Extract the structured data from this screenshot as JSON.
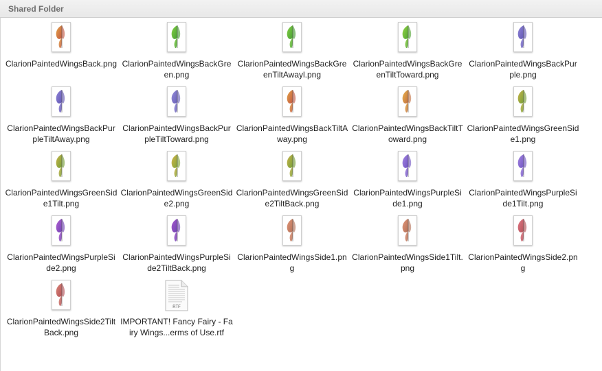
{
  "folder": {
    "title": "Shared Folder"
  },
  "files": [
    {
      "name": "ClarionPaintedWingsBack.png",
      "icon": "wing-thumbnail-icon",
      "c1": "#e2a03c",
      "c2": "#c0503a"
    },
    {
      "name": "ClarionPaintedWingsBackGreen.png",
      "icon": "wing-thumbnail-icon",
      "c1": "#7fcf3a",
      "c2": "#3e9a2a"
    },
    {
      "name": "ClarionPaintedWingsBackGreenTiltAwayl.png",
      "icon": "wing-thumbnail-icon",
      "c1": "#7fcf3a",
      "c2": "#3e9a2a"
    },
    {
      "name": "ClarionPaintedWingsBackGreenTiltToward.png",
      "icon": "wing-thumbnail-icon",
      "c1": "#8fd43a",
      "c2": "#4aa02a"
    },
    {
      "name": "ClarionPaintedWingsBackPurple.png",
      "icon": "wing-thumbnail-icon",
      "c1": "#8a7fd6",
      "c2": "#5b4fb0"
    },
    {
      "name": "ClarionPaintedWingsBackPurpleTiltAway.png",
      "icon": "wing-thumbnail-icon",
      "c1": "#8a7fd6",
      "c2": "#5b4fb0"
    },
    {
      "name": "ClarionPaintedWingsBackPurpleTiltToward.png",
      "icon": "wing-thumbnail-icon",
      "c1": "#9088d8",
      "c2": "#6258b4"
    },
    {
      "name": "ClarionPaintedWingsBackTiltAway.png",
      "icon": "wing-thumbnail-icon",
      "c1": "#e2a03c",
      "c2": "#c0503a"
    },
    {
      "name": "ClarionPaintedWingsBackTiltToward.png",
      "icon": "wing-thumbnail-icon",
      "c1": "#e8b040",
      "c2": "#c06a3a"
    },
    {
      "name": "ClarionPaintedWingsGreenSide1.png",
      "icon": "wing-thumbnail-icon",
      "c1": "#c8b040",
      "c2": "#6f9a2e"
    },
    {
      "name": "ClarionPaintedWingsGreenSide1Tilt.png",
      "icon": "wing-thumbnail-icon",
      "c1": "#c8b040",
      "c2": "#6f9a2e"
    },
    {
      "name": "ClarionPaintedWingsGreenSide2.png",
      "icon": "wing-thumbnail-icon",
      "c1": "#d4b040",
      "c2": "#7aa030"
    },
    {
      "name": "ClarionPaintedWingsGreenSide2TiltBack.png",
      "icon": "wing-thumbnail-icon",
      "c1": "#c8b040",
      "c2": "#6f9a2e"
    },
    {
      "name": "ClarionPaintedWingsPurpleSide1.png",
      "icon": "wing-thumbnail-icon",
      "c1": "#a080e0",
      "c2": "#6a4cc0"
    },
    {
      "name": "ClarionPaintedWingsPurpleSide1Tilt.png",
      "icon": "wing-thumbnail-icon",
      "c1": "#a080e0",
      "c2": "#6a4cc0"
    },
    {
      "name": "ClarionPaintedWingsPurpleSide2.png",
      "icon": "wing-thumbnail-icon",
      "c1": "#b058d0",
      "c2": "#6a3ab0"
    },
    {
      "name": "ClarionPaintedWingsPurpleSide2TiltBack.png",
      "icon": "wing-thumbnail-icon",
      "c1": "#a050c8",
      "c2": "#6a3ab0"
    },
    {
      "name": "ClarionPaintedWingsSide1.png",
      "icon": "wing-thumbnail-icon",
      "c1": "#e09070",
      "c2": "#b06a50"
    },
    {
      "name": "ClarionPaintedWingsSide1Tilt.png",
      "icon": "wing-thumbnail-icon",
      "c1": "#e09070",
      "c2": "#b06a50"
    },
    {
      "name": "ClarionPaintedWingsSide2.png",
      "icon": "wing-thumbnail-icon",
      "c1": "#e07080",
      "c2": "#b04a50"
    },
    {
      "name": "ClarionPaintedWingsSide2TiltBack.png",
      "icon": "wing-thumbnail-icon",
      "c1": "#d88070",
      "c2": "#b04a50"
    },
    {
      "name": "IMPORTANT! Fancy Fairy - Fairy Wings...erms of Use.rtf",
      "icon": "rtf-document-icon",
      "type_label": "RTF"
    }
  ]
}
